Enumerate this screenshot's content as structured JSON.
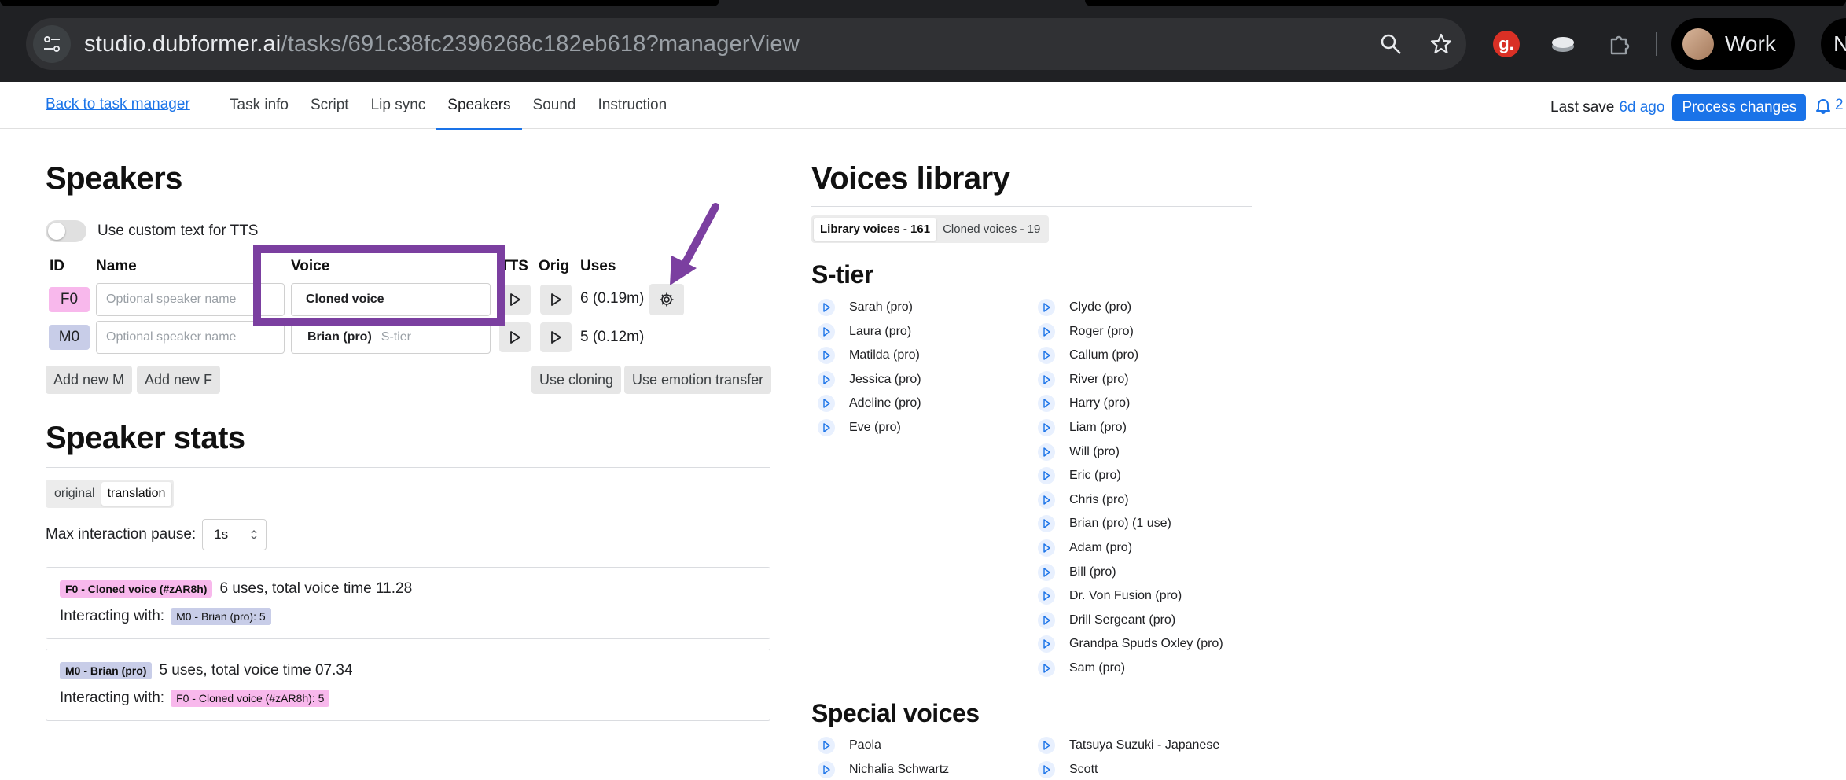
{
  "browser": {
    "url_host": "studio.dubformer.ai",
    "url_path": "/tasks/691c38fc2396268c182eb618?managerView",
    "profile_name": "Work",
    "profile2_initial": "N",
    "extension_g": "g."
  },
  "nav": {
    "back_link": "Back to task manager",
    "tabs": [
      "Task info",
      "Script",
      "Lip sync",
      "Speakers",
      "Sound",
      "Instruction"
    ],
    "active_tab": "Speakers",
    "last_save_label": "Last save",
    "last_save_ago": "6d ago",
    "process_button": "Process changes",
    "notifications": "2"
  },
  "speakers": {
    "title": "Speakers",
    "custom_tts_label": "Use custom text for TTS",
    "columns": {
      "id": "ID",
      "name": "Name",
      "voice": "Voice",
      "tts": "TTS",
      "orig": "Orig",
      "uses": "Uses"
    },
    "rows": [
      {
        "id": "F0",
        "name_placeholder": "Optional speaker name",
        "voice": "Cloned voice",
        "tier": "",
        "uses": "6 (0.19m)",
        "color": "#f8b8ec"
      },
      {
        "id": "M0",
        "name_placeholder": "Optional speaker name",
        "voice": "Brian (pro)",
        "tier": "S-tier",
        "uses": "5 (0.12m)",
        "color": "#c8cde8"
      }
    ],
    "buttons": {
      "add_m": "Add new M",
      "add_f": "Add new F",
      "use_cloning": "Use cloning",
      "use_emotion": "Use emotion transfer"
    },
    "annotation_color": "#7b3fa0"
  },
  "stats": {
    "title": "Speaker stats",
    "toggle": [
      "original",
      "translation"
    ],
    "active_toggle": "translation",
    "pause_label": "Max interaction pause:",
    "pause_value": "1s",
    "cards": [
      {
        "pill": "F0 - Cloned voice (#zAR8h)",
        "summary": "6 uses, total voice time 11.28",
        "interacting_label": "Interacting with:",
        "interacting_pill": "M0 - Brian (pro): 5"
      },
      {
        "pill": "M0 - Brian (pro)",
        "summary": "5 uses, total voice time 07.34",
        "interacting_label": "Interacting with:",
        "interacting_pill": "F0 - Cloned voice (#zAR8h): 5"
      }
    ]
  },
  "library": {
    "title": "Voices library",
    "toggle": [
      "Library voices - 161",
      "Cloned voices - 19"
    ],
    "active_toggle": "Library voices - 161",
    "s_tier_title": "S-tier",
    "s_tier_col1": [
      "Sarah (pro)",
      "Laura (pro)",
      "Matilda (pro)",
      "Jessica (pro)",
      "Adeline (pro)",
      "Eve (pro)"
    ],
    "s_tier_col2": [
      "Clyde (pro)",
      "Roger (pro)",
      "Callum (pro)",
      "River (pro)",
      "Harry (pro)",
      "Liam (pro)",
      "Will (pro)",
      "Eric (pro)",
      "Chris (pro)",
      "Brian (pro) (1 use)",
      "Adam (pro)",
      "Bill (pro)",
      "Dr. Von Fusion (pro)",
      "Drill Sergeant (pro)",
      "Grandpa Spuds Oxley (pro)",
      "Sam (pro)"
    ],
    "special_title": "Special voices",
    "special_col1": [
      "Paola",
      "Nichalia Schwartz"
    ],
    "special_col2": [
      "Tatsuya Suzuki - Japanese",
      "Scott"
    ]
  }
}
